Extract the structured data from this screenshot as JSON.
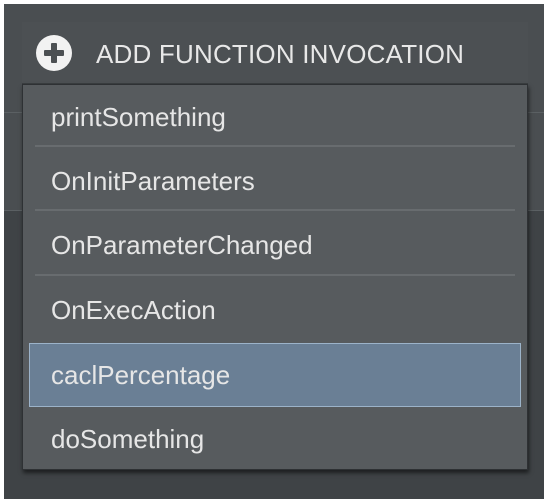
{
  "add_button": {
    "label": "ADD FUNCTION INVOCATION",
    "icon": "plus-circle-icon"
  },
  "menu": {
    "selected_index": 4,
    "items": [
      {
        "label": "printSomething"
      },
      {
        "label": "OnInitParameters"
      },
      {
        "label": "OnParameterChanged"
      },
      {
        "label": "OnExecAction"
      },
      {
        "label": "caclPercentage"
      },
      {
        "label": "doSomething"
      }
    ]
  },
  "colors": {
    "selected_background": "#6a7f95",
    "selected_border": "#9cb3c9",
    "menu_background": "#575b5e",
    "text": "#e6e6e6"
  }
}
